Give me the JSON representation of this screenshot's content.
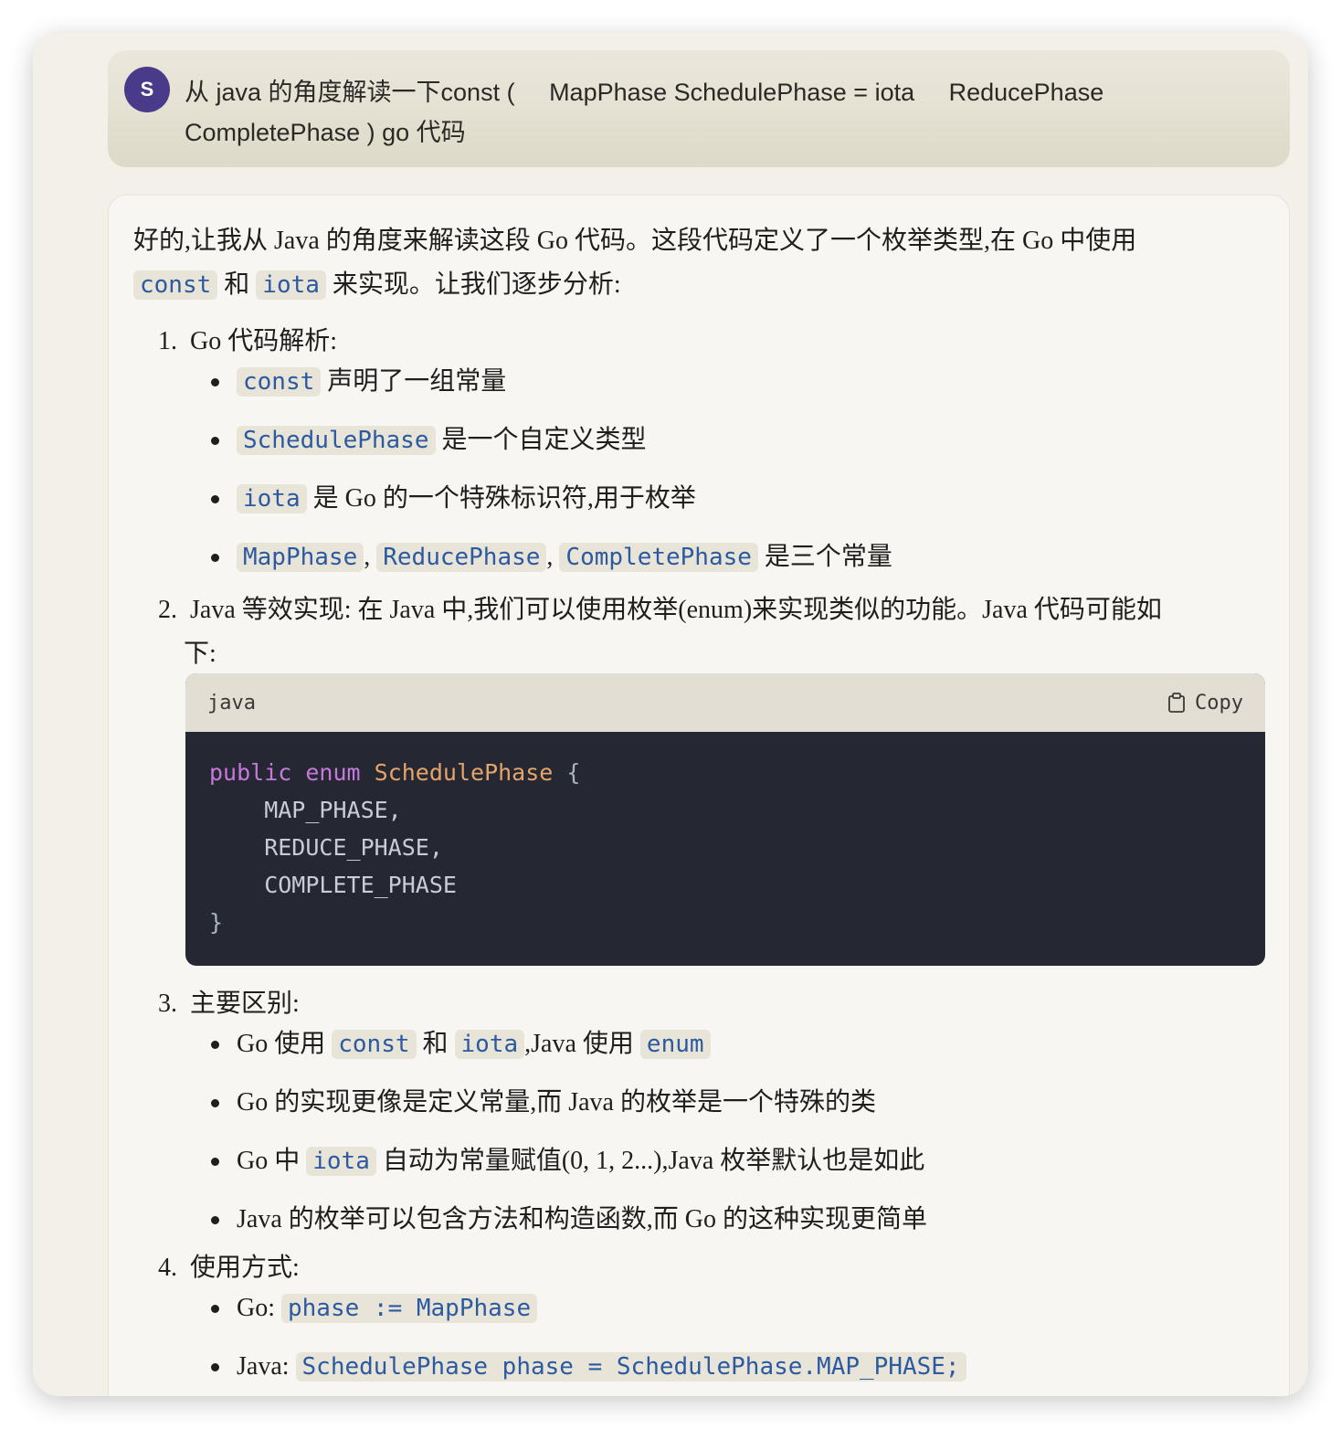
{
  "user_message": {
    "avatar_letter": "S",
    "text": "从 java 的角度解读一下const (     MapPhase SchedulePhase = iota     ReducePhase     CompletePhase ) go 代码"
  },
  "assistant": {
    "intro_line1": "好的,让我从 Java 的角度来解读这段 Go 代码。这段代码定义了一个枚举类型,在 Go 中使用",
    "intro_code1": "const",
    "intro_and": "和",
    "intro_code2": "iota",
    "intro_tail": "来实现。让我们逐步分析:",
    "section1": {
      "number": "1.",
      "title": "Go 代码解析:",
      "items": [
        {
          "code": "const",
          "text": "声明了一组常量"
        },
        {
          "code": "SchedulePhase",
          "text": "是一个自定义类型"
        },
        {
          "code": "iota",
          "text": "是 Go 的一个特殊标识符,用于枚举"
        },
        {
          "code1": "MapPhase",
          "sep1": ",",
          "code2": "ReducePhase",
          "sep2": ",",
          "code3": "CompletePhase",
          "text": "是三个常量"
        }
      ]
    },
    "section2": {
      "number": "2.",
      "line1": "Java 等效实现: 在 Java 中,我们可以使用枚举(enum)来实现类似的功能。Java 代码可能如",
      "line2": "下:"
    },
    "code_block": {
      "language": "java",
      "copy_label": "Copy",
      "kw_public": "public",
      "kw_enum": "enum",
      "type_name": "SchedulePhase",
      "open_brace": "{",
      "line_map": "    MAP_PHASE,",
      "line_reduce": "    REDUCE_PHASE,",
      "line_complete": "    COMPLETE_PHASE",
      "close_brace": "}"
    },
    "section3": {
      "number": "3.",
      "title": "主要区别:",
      "item1": {
        "pre": "Go 使用",
        "code1": "const",
        "and": "和",
        "code2": "iota",
        "mid": ",Java 使用",
        "code3": "enum"
      },
      "item2": "Go 的实现更像是定义常量,而 Java 的枚举是一个特殊的类",
      "item3": {
        "pre": "Go 中",
        "code": "iota",
        "post": "自动为常量赋值(0, 1, 2...),Java 枚举默认也是如此"
      },
      "item4": "Java 的枚举可以包含方法和构造函数,而 Go 的这种实现更简单"
    },
    "section4": {
      "number": "4.",
      "title": "使用方式:",
      "go_label": "Go:",
      "go_code": "phase := MapPhase",
      "java_label": "Java:",
      "java_code": "SchedulePhase phase = SchedulePhase.MAP_PHASE;"
    }
  }
}
